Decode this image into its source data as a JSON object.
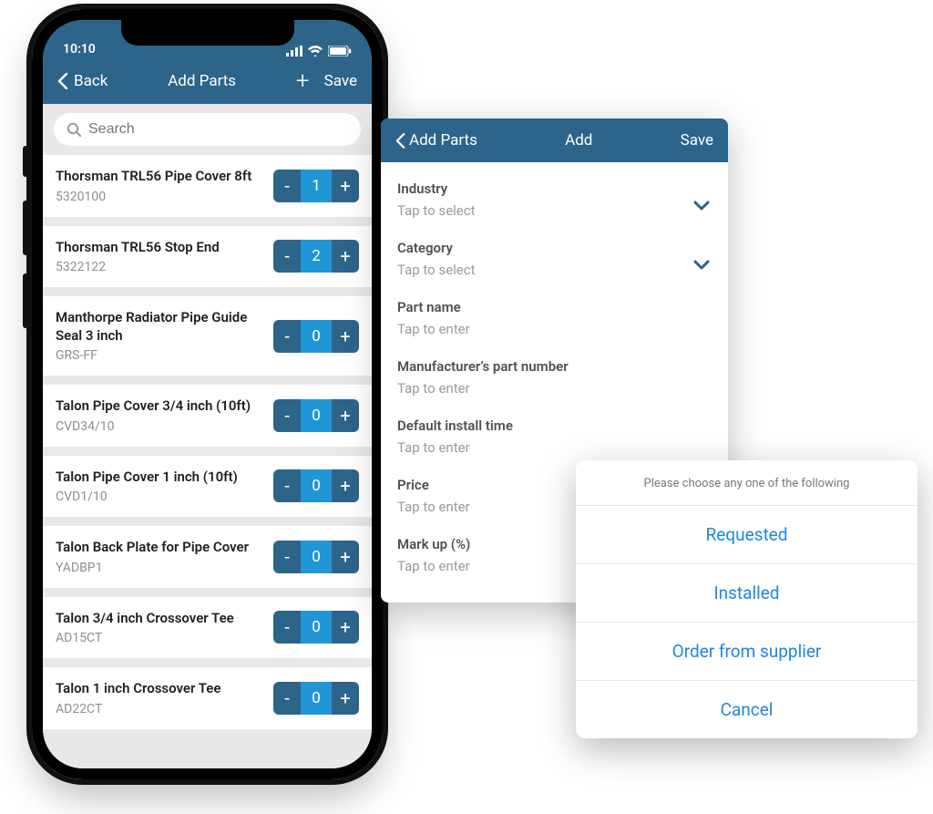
{
  "status": {
    "time": "10:10"
  },
  "nav": {
    "back": "Back",
    "title": "Add Parts",
    "save": "Save"
  },
  "search": {
    "placeholder": "Search"
  },
  "parts": [
    {
      "name": "Thorsman TRL56 Pipe Cover 8ft",
      "sku": "5320100",
      "qty": "1"
    },
    {
      "name": "Thorsman TRL56 Stop End",
      "sku": "5322122",
      "qty": "2"
    },
    {
      "name": "Manthorpe Radiator Pipe Guide Seal 3 inch",
      "sku": "GRS-FF",
      "qty": "0"
    },
    {
      "name": "Talon Pipe Cover 3/4 inch (10ft)",
      "sku": "CVD34/10",
      "qty": "0"
    },
    {
      "name": "Talon Pipe Cover 1 inch (10ft)",
      "sku": "CVD1/10",
      "qty": "0"
    },
    {
      "name": "Talon Back Plate for Pipe Cover",
      "sku": "YADBP1",
      "qty": "0"
    },
    {
      "name": "Talon 3/4 inch Crossover Tee",
      "sku": "AD15CT",
      "qty": "0"
    },
    {
      "name": "Talon 1 inch Crossover Tee",
      "sku": "AD22CT",
      "qty": "0"
    }
  ],
  "addPanel": {
    "back": "Add Parts",
    "title": "Add",
    "save": "Save",
    "fields": {
      "industry": {
        "label": "Industry",
        "placeholder": "Tap to select"
      },
      "category": {
        "label": "Category",
        "placeholder": "Tap to select"
      },
      "partName": {
        "label": "Part name",
        "placeholder": "Tap to enter"
      },
      "mpn": {
        "label": "Manufacturer’s part number",
        "placeholder": "Tap to enter"
      },
      "installTime": {
        "label": "Default install time",
        "placeholder": "Tap to enter"
      },
      "price": {
        "label": "Price",
        "placeholder": "Tap to enter"
      },
      "markup": {
        "label": "Mark up (%)",
        "placeholder": "Tap to enter"
      }
    }
  },
  "sheet": {
    "title": "Please choose any one of the following",
    "opt1": "Requested",
    "opt2": "Installed",
    "opt3": "Order from supplier",
    "opt4": "Cancel"
  }
}
